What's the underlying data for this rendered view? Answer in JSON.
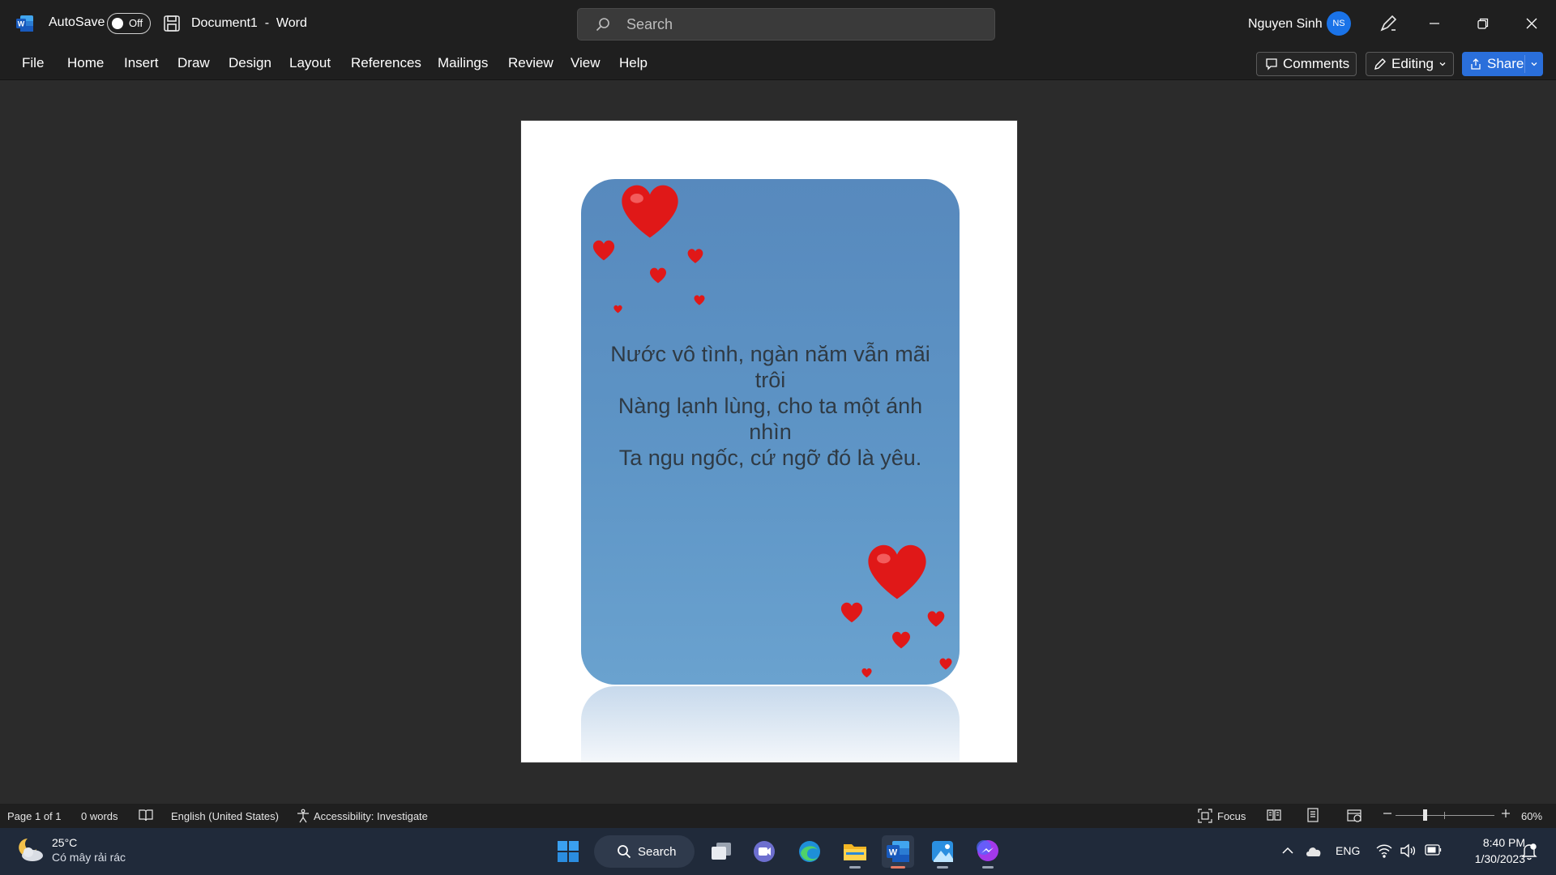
{
  "titlebar": {
    "autosave_label": "AutoSave",
    "autosave_state": "Off",
    "doc_title": "Document1  -  Word",
    "search_placeholder": "Search",
    "user_name": "Nguyen Sinh",
    "user_initials": "NS"
  },
  "ribbon": {
    "tabs": [
      "File",
      "Home",
      "Insert",
      "Draw",
      "Design",
      "Layout",
      "References",
      "Mailings",
      "Review",
      "View",
      "Help"
    ],
    "comments_label": "Comments",
    "editing_label": "Editing",
    "share_label": "Share"
  },
  "document": {
    "poem_lines": [
      "Nước vô tình, ngàn năm vẫn mãi",
      "trôi",
      "Nàng lạnh lùng, cho ta một ánh",
      "nhìn",
      "Ta ngu ngốc, cứ ngỡ đó là yêu."
    ]
  },
  "statusbar": {
    "page": "Page 1 of 1",
    "words": "0 words",
    "language": "English (United States)",
    "accessibility": "Accessibility: Investigate",
    "focus": "Focus",
    "zoom": "60%"
  },
  "taskbar": {
    "weather_temp": "25°C",
    "weather_desc": "Có mây rải rác",
    "search_label": "Search",
    "language": "ENG",
    "time": "8:40 PM",
    "date": "1/30/2023"
  },
  "colors": {
    "accent": "#2a6fdb",
    "heart": "#e01818",
    "card_blue": "#5e95c6"
  }
}
